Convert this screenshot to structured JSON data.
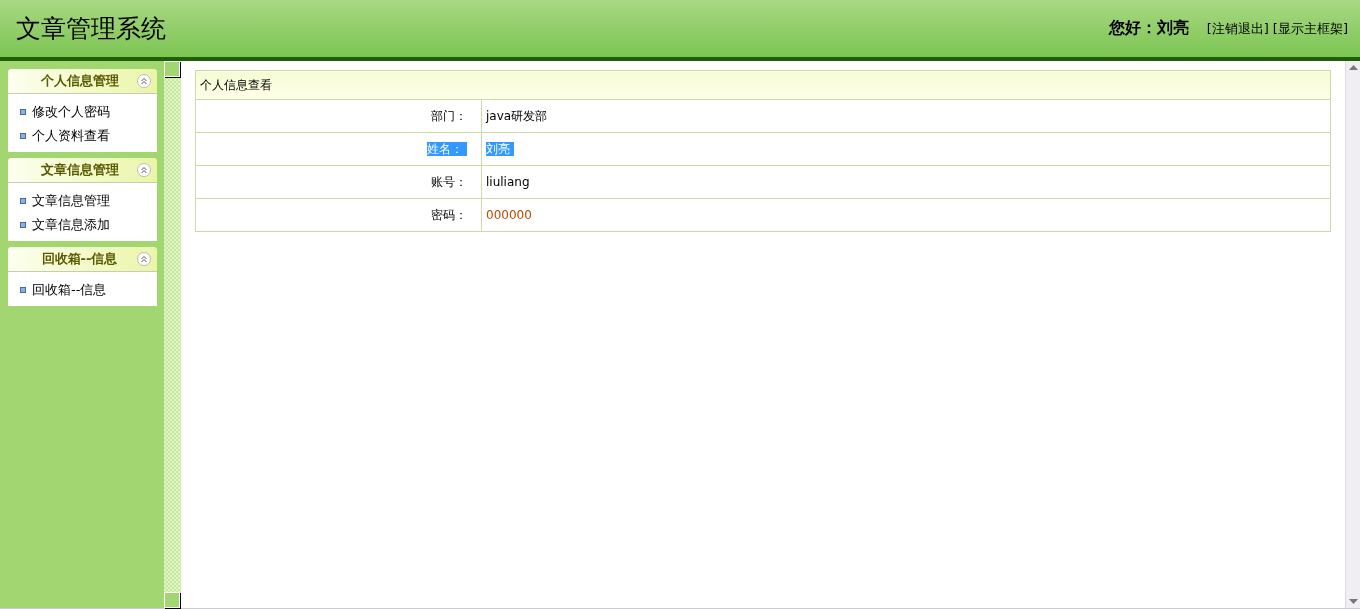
{
  "header": {
    "title": "文章管理系统",
    "greeting": "您好：刘亮",
    "links": [
      "[注销退出]",
      "[显示主框架]"
    ]
  },
  "sidebar": {
    "groups": [
      {
        "title": "个人信息管理",
        "expanded": true,
        "items": [
          "修改个人密码",
          "个人资料查看"
        ]
      },
      {
        "title": "文章信息管理",
        "expanded": true,
        "items": [
          "文章信息管理",
          "文章信息添加"
        ]
      },
      {
        "title": "回收箱--信息",
        "expanded": true,
        "items": [
          "回收箱--信息"
        ]
      }
    ]
  },
  "panel": {
    "title": "个人信息查看",
    "rows": [
      {
        "label": "部门：",
        "value": "java研发部",
        "selected": false,
        "color": "#000000"
      },
      {
        "label": "姓名：",
        "value": "刘亮",
        "selected": true
      },
      {
        "label": "账号：",
        "value": "liuliang",
        "selected": false,
        "color": "#000000"
      },
      {
        "label": "密码：",
        "value": "000000",
        "selected": false,
        "color": "#c04a00"
      }
    ]
  }
}
